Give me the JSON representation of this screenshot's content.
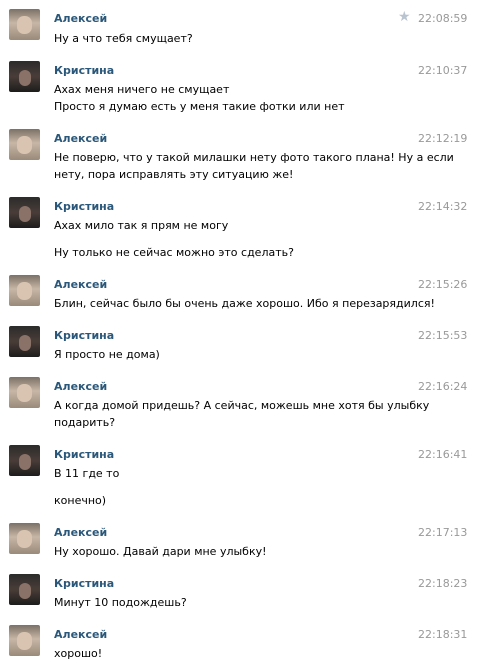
{
  "messages": [
    {
      "author": "Алексей",
      "time": "22:08:59",
      "lines": [
        "Ну а что тебя смущает?"
      ]
    },
    {
      "author": "Кристина",
      "time": "22:10:37",
      "lines": [
        "Ахах меня ничего не смущает",
        "Просто я думаю есть у меня такие фотки или нет"
      ]
    },
    {
      "author": "Алексей",
      "time": "22:12:19",
      "lines": [
        "Не поверю, что у такой милашки нету фото такого плана! Ну а если",
        "нету, пора исправлять эту ситуацию же!"
      ]
    },
    {
      "author": "Кристина",
      "time": "22:14:32",
      "lines": [
        "Ахах мило так я прям не могу",
        "Ну только не сейчас можно это сделать?"
      ]
    },
    {
      "author": "Алексей",
      "time": "22:15:26",
      "lines": [
        "Блин, сейчас было бы очень даже хорошо. Ибо я перезарядился!"
      ]
    },
    {
      "author": "Кристина",
      "time": "22:15:53",
      "lines": [
        "Я просто не дома)"
      ]
    },
    {
      "author": "Алексей",
      "time": "22:16:24",
      "lines": [
        "А когда домой придешь? А сейчас, можешь мне хотя бы улыбку",
        "подарить?"
      ]
    },
    {
      "author": "Кристина",
      "time": "22:16:41",
      "lines": [
        "В 11 где то",
        "конечно)"
      ]
    },
    {
      "author": "Алексей",
      "time": "22:17:13",
      "lines": [
        "Ну хорошо. Давай дари мне улыбку!"
      ]
    },
    {
      "author": "Кристина",
      "time": "22:18:23",
      "lines": [
        "Минут 10 подождешь?"
      ]
    },
    {
      "author": "Алексей",
      "time": "22:18:31",
      "lines": [
        "хорошо!"
      ]
    }
  ],
  "icons": {
    "favorite": "star-icon"
  },
  "colors": {
    "author": "#2b587a",
    "time": "#999999",
    "star": "#b9c4d0"
  }
}
